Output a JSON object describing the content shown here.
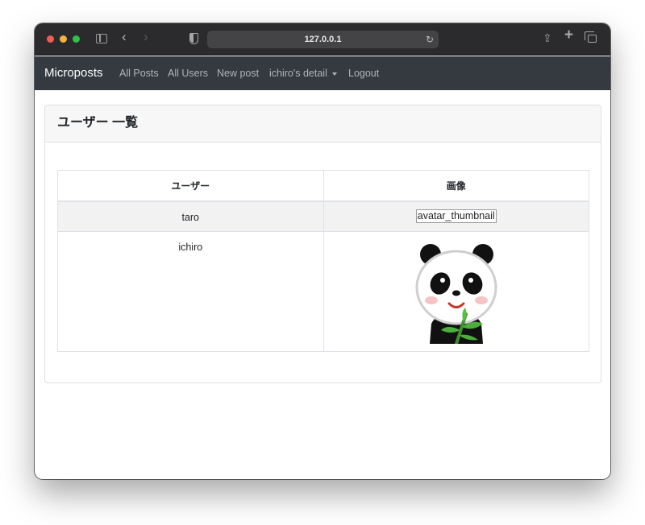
{
  "browser": {
    "url": "127.0.0.1",
    "icons": {
      "sidebar": "sidebar-icon",
      "back": "chevron-left-icon",
      "forward": "chevron-right-icon",
      "shield": "shield-icon",
      "reload": "reload-icon",
      "share": "share-icon",
      "new_tab": "plus-icon",
      "tabs": "tabs-overview-icon"
    },
    "glyphs": {
      "back": "‹",
      "forward": "›",
      "reload": "↻",
      "share": "⇪",
      "new_tab": "+"
    }
  },
  "navbar": {
    "brand": "Microposts",
    "links": {
      "all_posts": "All Posts",
      "all_users": "All Users",
      "new_post": "New post",
      "user_detail": "ichiro's detail",
      "logout": "Logout"
    },
    "colors": {
      "background": "#343a40",
      "brand": "#ffffff",
      "link": "#b1b4b7"
    }
  },
  "page": {
    "title": "ユーザー 一覧",
    "table": {
      "headers": {
        "user": "ユーザー",
        "image": "画像"
      },
      "rows": [
        {
          "user": "taro",
          "image_alt": "avatar_thumbnail"
        },
        {
          "user": "ichiro",
          "image": "panda-avatar"
        }
      ]
    }
  }
}
